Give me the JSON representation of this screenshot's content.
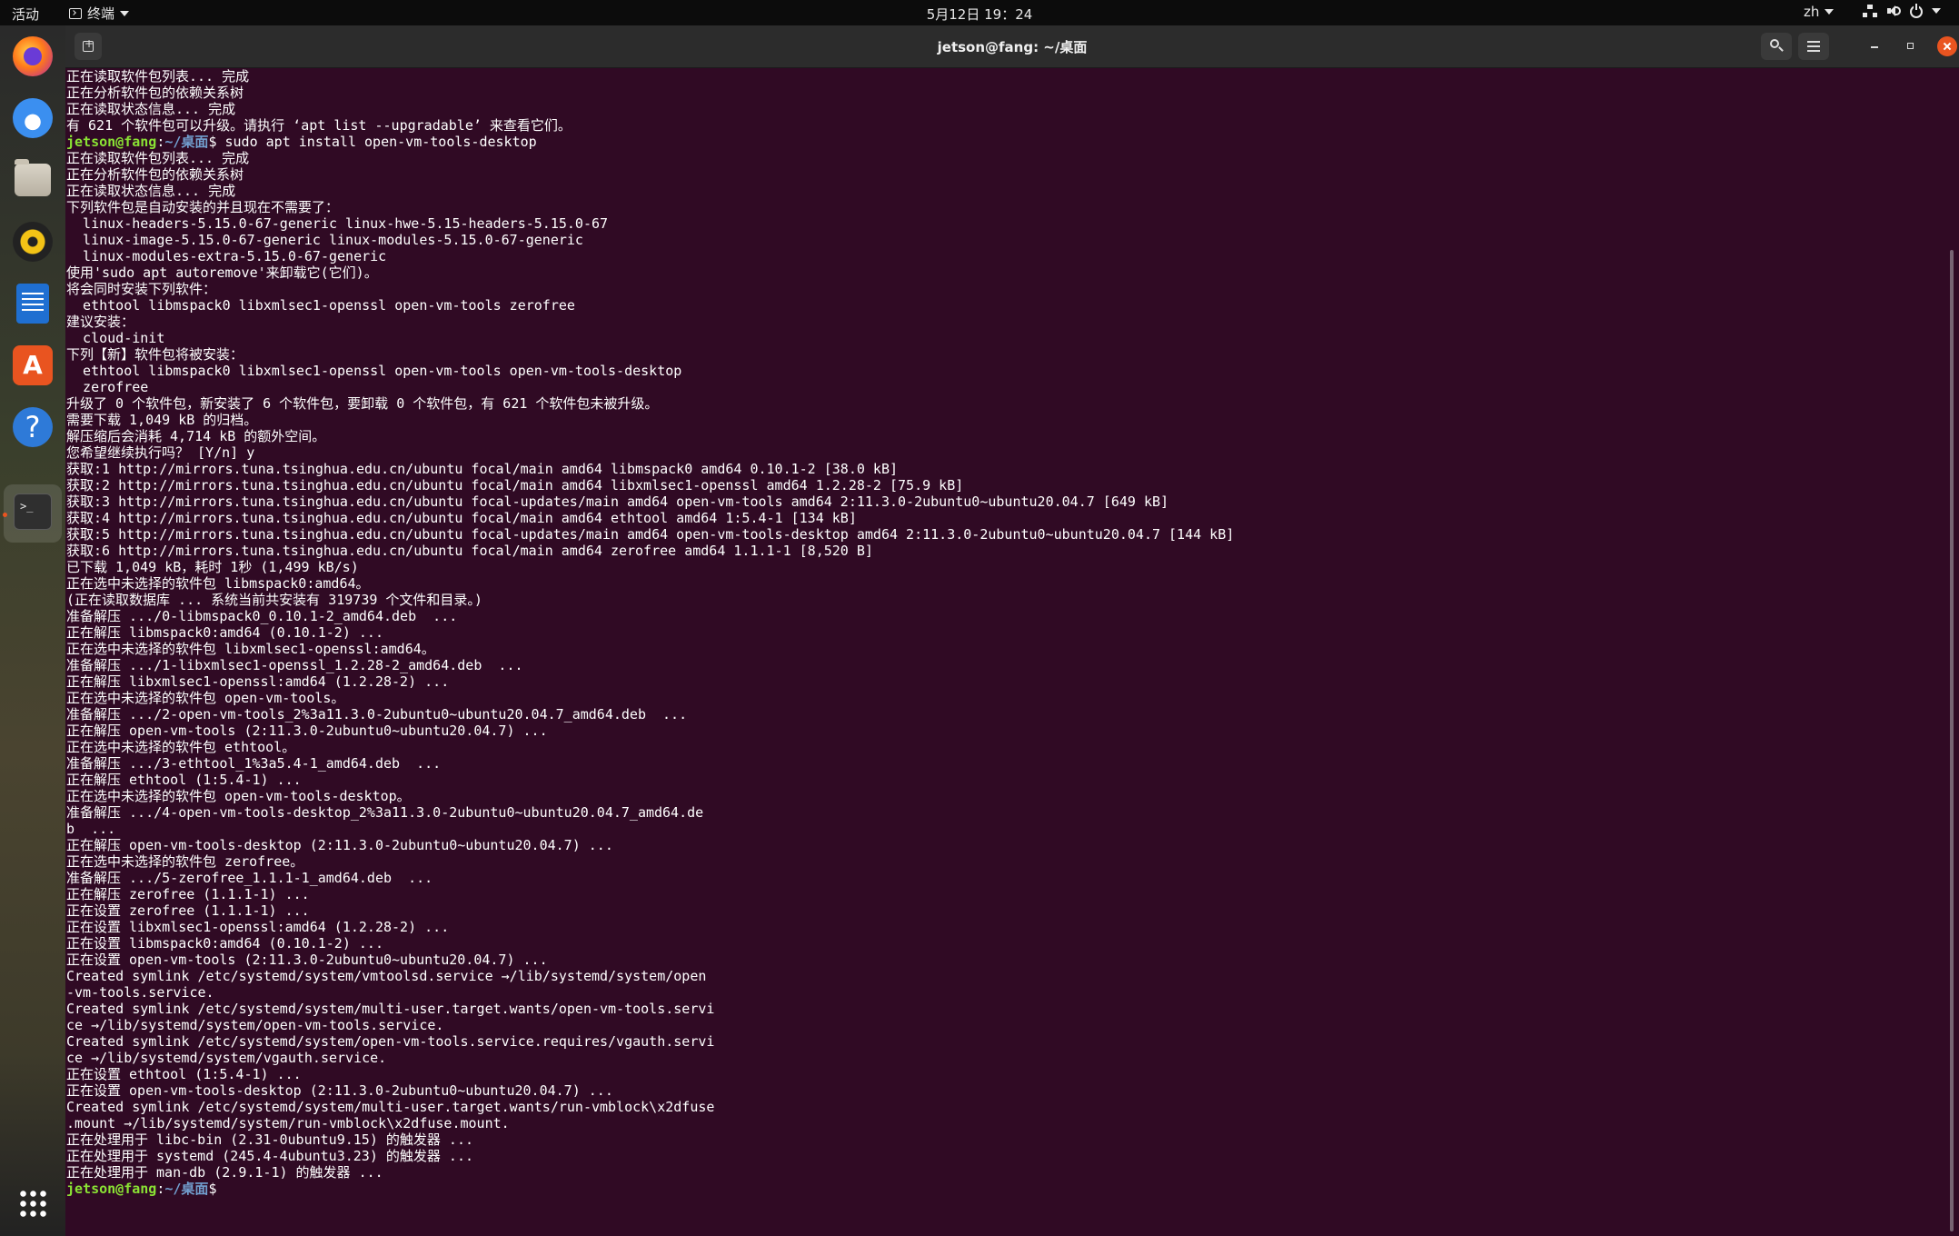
{
  "topbar": {
    "activities": "活动",
    "app_menu": "终端",
    "clock": "5月12日  19：24",
    "input_method": "zh"
  },
  "window": {
    "title": "jetson@fang: ~/桌面"
  },
  "terminal": {
    "prompt_user": "jetson@fang",
    "prompt_path": "~/桌面",
    "lines": [
      "正在读取软件包列表... 完成",
      "正在分析软件包的依赖关系树",
      "正在读取状态信息... 完成",
      "有 621 个软件包可以升级。请执行 ‘apt list --upgradable’ 来查看它们。",
      "$ sudo apt install open-vm-tools-desktop",
      "正在读取软件包列表... 完成",
      "正在分析软件包的依赖关系树",
      "正在读取状态信息... 完成",
      "下列软件包是自动安装的并且现在不需要了：",
      "  linux-headers-5.15.0-67-generic linux-hwe-5.15-headers-5.15.0-67",
      "  linux-image-5.15.0-67-generic linux-modules-5.15.0-67-generic",
      "  linux-modules-extra-5.15.0-67-generic",
      "使用'sudo apt autoremove'来卸载它(它们)。",
      "将会同时安装下列软件：",
      "  ethtool libmspack0 libxmlsec1-openssl open-vm-tools zerofree",
      "建议安装：",
      "  cloud-init",
      "下列【新】软件包将被安装：",
      "  ethtool libmspack0 libxmlsec1-openssl open-vm-tools open-vm-tools-desktop",
      "  zerofree",
      "升级了 0 个软件包，新安装了 6 个软件包，要卸载 0 个软件包，有 621 个软件包未被升级。",
      "需要下载 1,049 kB 的归档。",
      "解压缩后会消耗 4,714 kB 的额外空间。",
      "您希望继续执行吗？ [Y/n] y",
      "获取:1 http://mirrors.tuna.tsinghua.edu.cn/ubuntu focal/main amd64 libmspack0 amd64 0.10.1-2 [38.0 kB]",
      "获取:2 http://mirrors.tuna.tsinghua.edu.cn/ubuntu focal/main amd64 libxmlsec1-openssl amd64 1.2.28-2 [75.9 kB]",
      "获取:3 http://mirrors.tuna.tsinghua.edu.cn/ubuntu focal-updates/main amd64 open-vm-tools amd64 2:11.3.0-2ubuntu0~ubuntu20.04.7 [649 kB]",
      "获取:4 http://mirrors.tuna.tsinghua.edu.cn/ubuntu focal/main amd64 ethtool amd64 1:5.4-1 [134 kB]",
      "获取:5 http://mirrors.tuna.tsinghua.edu.cn/ubuntu focal-updates/main amd64 open-vm-tools-desktop amd64 2:11.3.0-2ubuntu0~ubuntu20.04.7 [144 kB]",
      "获取:6 http://mirrors.tuna.tsinghua.edu.cn/ubuntu focal/main amd64 zerofree amd64 1.1.1-1 [8,520 B]",
      "已下载 1,049 kB，耗时 1秒 (1,499 kB/s)",
      "正在选中未选择的软件包 libmspack0:amd64。",
      "(正在读取数据库 ... 系统当前共安装有 319739 个文件和目录。)",
      "准备解压 .../0-libmspack0_0.10.1-2_amd64.deb  ...",
      "正在解压 libmspack0:amd64 (0.10.1-2) ...",
      "正在选中未选择的软件包 libxmlsec1-openssl:amd64。",
      "准备解压 .../1-libxmlsec1-openssl_1.2.28-2_amd64.deb  ...",
      "正在解压 libxmlsec1-openssl:amd64 (1.2.28-2) ...",
      "正在选中未选择的软件包 open-vm-tools。",
      "准备解压 .../2-open-vm-tools_2%3a11.3.0-2ubuntu0~ubuntu20.04.7_amd64.deb  ...",
      "正在解压 open-vm-tools (2:11.3.0-2ubuntu0~ubuntu20.04.7) ...",
      "正在选中未选择的软件包 ethtool。",
      "准备解压 .../3-ethtool_1%3a5.4-1_amd64.deb  ...",
      "正在解压 ethtool (1:5.4-1) ...",
      "正在选中未选择的软件包 open-vm-tools-desktop。",
      "准备解压 .../4-open-vm-tools-desktop_2%3a11.3.0-2ubuntu0~ubuntu20.04.7_amd64.de",
      "b  ...",
      "正在解压 open-vm-tools-desktop (2:11.3.0-2ubuntu0~ubuntu20.04.7) ...",
      "正在选中未选择的软件包 zerofree。",
      "准备解压 .../5-zerofree_1.1.1-1_amd64.deb  ...",
      "正在解压 zerofree (1.1.1-1) ...",
      "正在设置 zerofree (1.1.1-1) ...",
      "正在设置 libxmlsec1-openssl:amd64 (1.2.28-2) ...",
      "正在设置 libmspack0:amd64 (0.10.1-2) ...",
      "正在设置 open-vm-tools (2:11.3.0-2ubuntu0~ubuntu20.04.7) ...",
      "Created symlink /etc/systemd/system/vmtoolsd.service →/lib/systemd/system/open",
      "-vm-tools.service.",
      "Created symlink /etc/systemd/system/multi-user.target.wants/open-vm-tools.servi",
      "ce →/lib/systemd/system/open-vm-tools.service.",
      "Created symlink /etc/systemd/system/open-vm-tools.service.requires/vgauth.servi",
      "ce →/lib/systemd/system/vgauth.service.",
      "正在设置 ethtool (1:5.4-1) ...",
      "正在设置 open-vm-tools-desktop (2:11.3.0-2ubuntu0~ubuntu20.04.7) ...",
      "Created symlink /etc/systemd/system/multi-user.target.wants/run-vmblock\\x2dfuse",
      ".mount →/lib/systemd/system/run-vmblock\\x2dfuse.mount.",
      "正在处理用于 libc-bin (2.31-0ubuntu9.15) 的触发器 ...",
      "正在处理用于 systemd (245.4-4ubuntu3.23) 的触发器 ...",
      "正在处理用于 man-db (2.9.1-1) 的触发器 ...",
      "$"
    ]
  },
  "dock": {
    "items": [
      "firefox-icon",
      "thunderbird-icon",
      "files-icon",
      "rhythmbox-icon",
      "libreoffice-writer-icon",
      "app-store-icon",
      "help-icon",
      "terminal-icon"
    ]
  }
}
